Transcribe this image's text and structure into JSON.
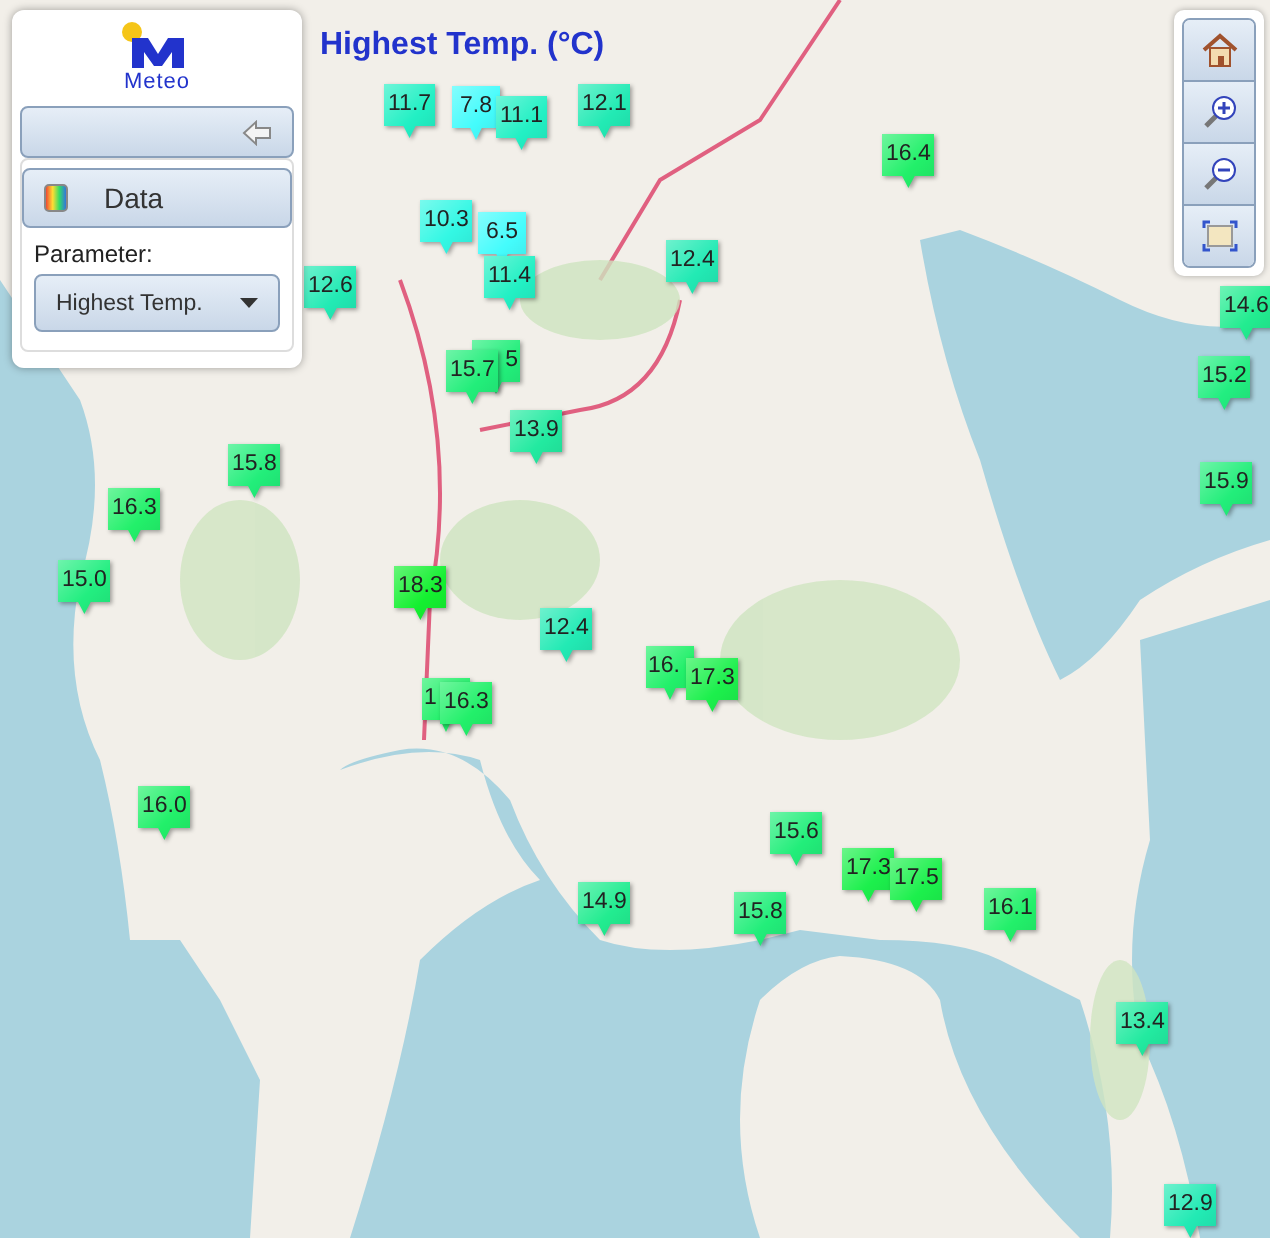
{
  "title": "Highest Temp. (°C)",
  "panel": {
    "logo_text": "Meteo",
    "data_button": "Data",
    "parameter_label": "Parameter:",
    "parameter_select": "Highest Temp."
  },
  "markers": [
    {
      "value": "11.7",
      "color": "#22f0c4"
    },
    {
      "value": "7.8",
      "color": "#44fcfc"
    },
    {
      "value": "11.1",
      "color": "#22f0c4"
    },
    {
      "value": "12.1",
      "color": "#22eab4"
    },
    {
      "value": "16.4",
      "color": "#22f06a"
    },
    {
      "value": "12.6",
      "color": "#22eab4"
    },
    {
      "value": "10.3",
      "color": "#33f8e4"
    },
    {
      "value": "6.5",
      "color": "#44fcfc"
    },
    {
      "value": "11.4",
      "color": "#22f0c4"
    },
    {
      "value": "12.4",
      "color": "#22eab4"
    },
    {
      "value": "14.6",
      "color": "#22ec90"
    },
    {
      "value": "5",
      "color": "#22ee7a"
    },
    {
      "value": "15.7",
      "color": "#22ee7a"
    },
    {
      "value": "15.2",
      "color": "#22ee80"
    },
    {
      "value": "13.9",
      "color": "#22eaa0"
    },
    {
      "value": "15.8",
      "color": "#22ee7a"
    },
    {
      "value": "15.9",
      "color": "#22ee7a"
    },
    {
      "value": "16.3",
      "color": "#22f06a"
    },
    {
      "value": "15.0",
      "color": "#22ee80"
    },
    {
      "value": "18.3",
      "color": "#14f030"
    },
    {
      "value": "12.4",
      "color": "#22eab4"
    },
    {
      "value": "16.",
      "color": "#22f06a"
    },
    {
      "value": "17.3",
      "color": "#1cf04c"
    },
    {
      "value": "1",
      "color": "#22f06a"
    },
    {
      "value": "16.3",
      "color": "#22f06a"
    },
    {
      "value": "16.0",
      "color": "#22f06a"
    },
    {
      "value": "15.6",
      "color": "#22ee7a"
    },
    {
      "value": "17.3",
      "color": "#1cf04c"
    },
    {
      "value": "17.5",
      "color": "#1cf04c"
    },
    {
      "value": "14.9",
      "color": "#22ec90"
    },
    {
      "value": "15.8",
      "color": "#22ee7a"
    },
    {
      "value": "16.1",
      "color": "#22f06a"
    },
    {
      "value": "13.4",
      "color": "#22eaa0"
    },
    {
      "value": "12.9",
      "color": "#22eab4"
    }
  ]
}
